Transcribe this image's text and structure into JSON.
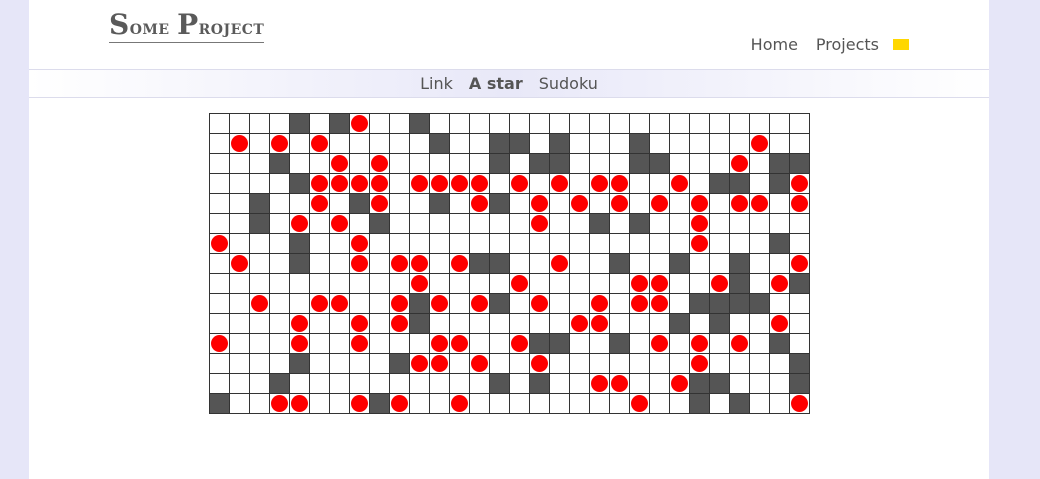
{
  "brand": {
    "first_initial": "S",
    "first_rest": "ome",
    "second_initial": "P",
    "second_rest": "roject"
  },
  "topnav": {
    "items": [
      "Home",
      "Projects"
    ],
    "flag_color": "#ffd700"
  },
  "subnav": {
    "items": [
      "Link",
      "A star",
      "Sudoku"
    ],
    "active": "A star"
  },
  "grid": {
    "columns": 30,
    "rows": 15,
    "legend": {
      "wall": "#",
      "path": "o",
      "empty": "."
    },
    "cells": [
      "....#.#o..#...................",
      ".o.o.o.....#..##.#...#.....o..",
      "...#..o.o.....#.##...##...o.##",
      "....#oooo.oooo.o.o.oo..o.##.#o",
      "..#..o.#o..#.o#.o.o.o.o.o.oo.o",
      "..#.o.o.#.......o..#.#..o.....",
      "o...#..o................o...#.",
      ".o..#..o.oo.o##..o..#..#..#..o",
      "..........o....o.....oo..o#.o#",
      "..o..oo..o#o.o#.o..o.oo.####..",
      "....o..o.o#.......oo...#.#..o.",
      "o...o..o...oo..o##..#.o.o.o.#.",
      "....#....#oo.o..o.......o....#",
      "...#..........#.#..oo..o##...#.",
      "#..oo..o#o..o........o..#.#..o."
    ]
  }
}
